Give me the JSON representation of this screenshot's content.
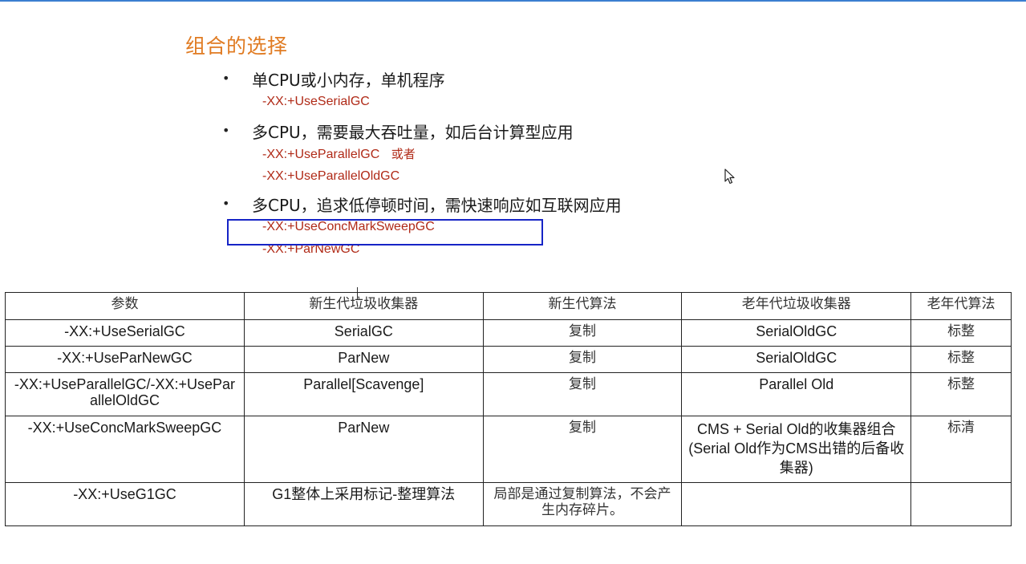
{
  "title": "组合的选择",
  "bullets": [
    {
      "text": "单CPU或小内存，单机程序",
      "options": [
        {
          "text": "-XX:+UseSerialGC",
          "suffix": ""
        }
      ]
    },
    {
      "text": "多CPU，需要最大吞吐量，如后台计算型应用",
      "options": [
        {
          "text": "-XX:+UseParallelGC",
          "suffix": "或者"
        },
        {
          "text": "-XX:+UseParallelOldGC",
          "suffix": ""
        }
      ]
    },
    {
      "text": "多CPU，追求低停顿时间，需快速响应如互联网应用",
      "options": [
        {
          "text": "-XX:+UseConcMarkSweepGC",
          "suffix": ""
        },
        {
          "text": "-XX:+ParNewGC",
          "suffix": ""
        }
      ]
    }
  ],
  "table": {
    "headers": [
      "参数",
      "新生代垃圾收集器",
      "新生代算法",
      "老年代垃圾收集器",
      "老年代算法"
    ],
    "rows": [
      [
        "-XX:+UseSerialGC",
        "SerialGC",
        "复制",
        "SerialOldGC",
        "标整"
      ],
      [
        "-XX:+UseParNewGC",
        "ParNew",
        "复制",
        "SerialOldGC",
        "标整"
      ],
      [
        "-XX:+UseParallelGC/-XX:+UseParallelOldGC",
        "Parallel[Scavenge]",
        "复制",
        "Parallel Old",
        "标整"
      ],
      [
        "-XX:+UseConcMarkSweepGC",
        "ParNew",
        "复制",
        "CMS + Serial Old的收集器组合 (Serial Old作为CMS出错的后备收集器)",
        "标清"
      ],
      [
        "-XX:+UseG1GC",
        "G1整体上采用标记-整理算法",
        "局部是通过复制算法，不会产生内存碎片。",
        "",
        ""
      ]
    ]
  },
  "icons": {
    "cursor": "mouse-pointer-icon"
  },
  "colors": {
    "title": "#e07b22",
    "option": "#b02a17",
    "highlight": "#1624c6"
  }
}
